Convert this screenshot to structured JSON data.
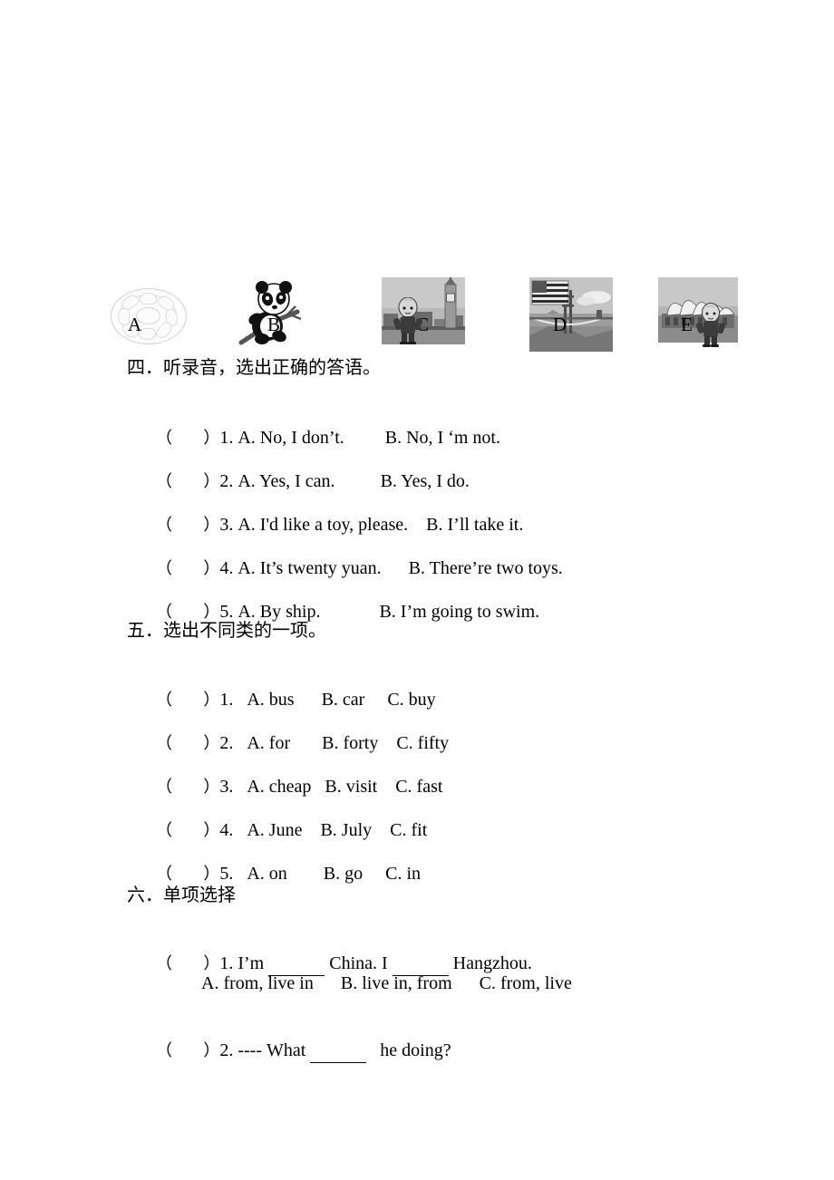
{
  "document": {
    "type": "english-exam-worksheet",
    "language": "zh-CN + en"
  },
  "picture_row": {
    "images": [
      {
        "label": "A",
        "name": "dim-sum-plate-image",
        "alt": "faint line drawing of a round plate of dim sum dumplings"
      },
      {
        "label": "B",
        "name": "panda-image",
        "alt": "panda eating bamboo"
      },
      {
        "label": "C",
        "name": "london-bigben-image",
        "alt": "child in front of Big Ben, London"
      },
      {
        "label": "D",
        "name": "usa-goldengate-image",
        "alt": "USA flag over Golden Gate Bridge"
      },
      {
        "label": "E",
        "name": "sydney-opera-house-image",
        "alt": "child in front of Sydney Opera House"
      }
    ],
    "labels": [
      "A",
      "B",
      "C",
      "D",
      "E"
    ]
  },
  "section_four": {
    "heading": "四．听录音，选出正确的答语。",
    "bracket": "（      ）",
    "questions": [
      {
        "num": "1.",
        "a": "A. No, I don’t.",
        "b": "B. No, I ‘m not."
      },
      {
        "num": "2.",
        "a": "A. Yes, I can.",
        "b": "B. Yes, I do."
      },
      {
        "num": "3.",
        "a": "A. I'd like a toy, please.",
        "b": "B. I’ll take it."
      },
      {
        "num": "4.",
        "a": "A. It’s twenty yuan.",
        "b": "B. There’re two toys."
      },
      {
        "num": "5.",
        "a": "A. By ship.",
        "b": "B. I’m going to swim."
      }
    ]
  },
  "section_five": {
    "heading": "五．选出不同类的一项。",
    "bracket": "（      ）",
    "questions": [
      {
        "num": "1.",
        "a": "A. bus",
        "b": "B. car",
        "c": "C. buy"
      },
      {
        "num": "2.",
        "a": "A. for",
        "b": "B. forty",
        "c": "C. fifty"
      },
      {
        "num": "3.",
        "a": "A. cheap",
        "b": "B. visit",
        "c": "C. fast"
      },
      {
        "num": "4.",
        "a": "A. June",
        "b": "B. July",
        "c": "C. fit"
      },
      {
        "num": "5.",
        "a": "A. on",
        "b": "B. go",
        "c": "C. in"
      }
    ]
  },
  "section_six": {
    "heading": "六．单项选择",
    "bracket": "（      ）",
    "questions": [
      {
        "num": "1.",
        "stem_parts": [
          "I’m ",
          " China. I ",
          " Hangzhou."
        ],
        "options_line": "A. from, live in      B. live in, from      C. from, live"
      },
      {
        "num": "2.",
        "stem_parts": [
          "---- What ",
          "   he doing?"
        ],
        "options_line": ""
      }
    ]
  }
}
